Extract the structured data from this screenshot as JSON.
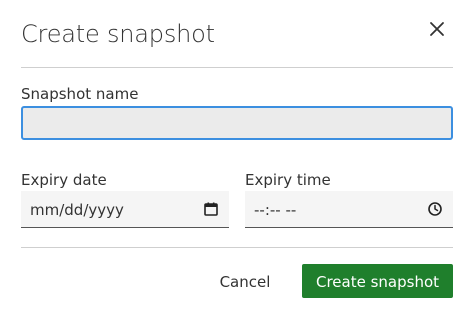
{
  "dialog": {
    "title": "Create snapshot",
    "close_icon": "close-icon"
  },
  "form": {
    "name_label": "Snapshot name",
    "name_value": "",
    "name_placeholder": "",
    "expiry_date_label": "Expiry date",
    "expiry_date_value": "mm/dd/yyyy",
    "expiry_date_icon": "calendar-icon",
    "expiry_time_label": "Expiry time",
    "expiry_time_value": "--:-- --",
    "expiry_time_icon": "clock-icon"
  },
  "actions": {
    "cancel_label": "Cancel",
    "create_label": "Create snapshot"
  },
  "colors": {
    "primary": "#1f7f2c",
    "focus": "#3c8fe0",
    "input_bg": "#ebebeb",
    "field_bg": "#f5f5f5",
    "text": "#333333",
    "divider": "#cfcfcf"
  }
}
